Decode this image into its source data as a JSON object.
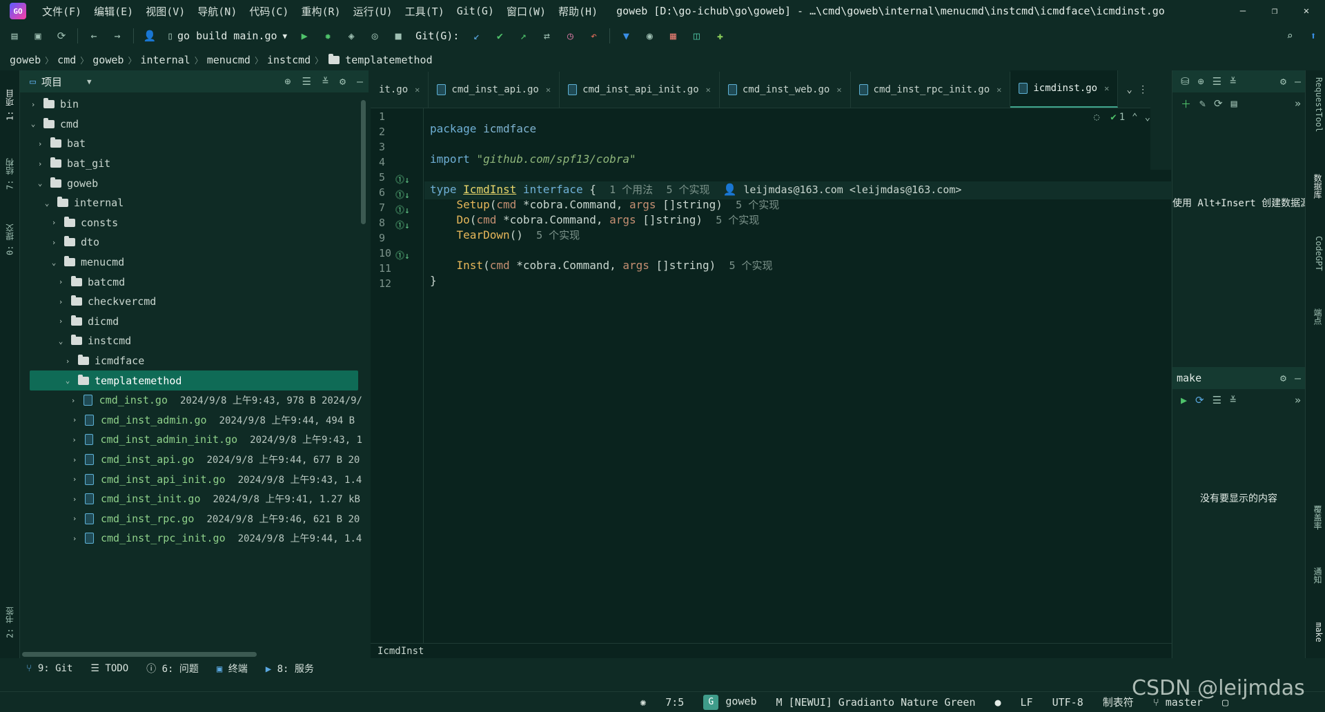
{
  "app": {
    "logo_text": "GO"
  },
  "menu": [
    "文件(F)",
    "编辑(E)",
    "视图(V)",
    "导航(N)",
    "代码(C)",
    "重构(R)",
    "运行(U)",
    "工具(T)",
    "Git(G)",
    "窗口(W)",
    "帮助(H)"
  ],
  "window_title": "goweb [D:\\go-ichub\\go\\goweb] - …\\cmd\\goweb\\internal\\menucmd\\instcmd\\icmdface\\icmdinst.go",
  "window_controls": {
    "minimize": "—",
    "maximize": "❐",
    "close": "✕"
  },
  "toolbar": {
    "run_config": "go build main.go",
    "git_label": "Git(G):"
  },
  "breadcrumb": [
    "goweb",
    "cmd",
    "goweb",
    "internal",
    "menucmd",
    "instcmd",
    "templatemethod"
  ],
  "project_panel": {
    "title": "项目"
  },
  "tree": [
    {
      "label": "bin",
      "type": "folder",
      "depth": 0,
      "expanded": false
    },
    {
      "label": "cmd",
      "type": "folder",
      "depth": 0,
      "expanded": true
    },
    {
      "label": "bat",
      "type": "folder",
      "depth": 1,
      "expanded": false
    },
    {
      "label": "bat_git",
      "type": "folder",
      "depth": 1,
      "expanded": false
    },
    {
      "label": "goweb",
      "type": "folder",
      "depth": 1,
      "expanded": true
    },
    {
      "label": "internal",
      "type": "folder",
      "depth": 2,
      "expanded": true
    },
    {
      "label": "consts",
      "type": "folder",
      "depth": 3,
      "expanded": false
    },
    {
      "label": "dto",
      "type": "folder",
      "depth": 3,
      "expanded": false
    },
    {
      "label": "menucmd",
      "type": "folder",
      "depth": 3,
      "expanded": true
    },
    {
      "label": "batcmd",
      "type": "folder",
      "depth": 4,
      "expanded": false
    },
    {
      "label": "checkvercmd",
      "type": "folder",
      "depth": 4,
      "expanded": false
    },
    {
      "label": "dicmd",
      "type": "folder",
      "depth": 4,
      "expanded": false
    },
    {
      "label": "instcmd",
      "type": "folder",
      "depth": 4,
      "expanded": true
    },
    {
      "label": "icmdface",
      "type": "folder",
      "depth": 5,
      "expanded": false
    },
    {
      "label": "templatemethod",
      "type": "folder",
      "depth": 5,
      "expanded": true,
      "selected": true
    },
    {
      "label": "cmd_inst.go",
      "type": "file",
      "depth": 6,
      "meta": "2024/9/8 上午9:43, 978 B 2024/9/"
    },
    {
      "label": "cmd_inst_admin.go",
      "type": "file",
      "depth": 6,
      "meta": "2024/9/8 上午9:44, 494 B"
    },
    {
      "label": "cmd_inst_admin_init.go",
      "type": "file",
      "depth": 6,
      "meta": "2024/9/8 上午9:43, 1"
    },
    {
      "label": "cmd_inst_api.go",
      "type": "file",
      "depth": 6,
      "meta": "2024/9/8 上午9:44, 677 B 20"
    },
    {
      "label": "cmd_inst_api_init.go",
      "type": "file",
      "depth": 6,
      "meta": "2024/9/8 上午9:43, 1.4"
    },
    {
      "label": "cmd_inst_init.go",
      "type": "file",
      "depth": 6,
      "meta": "2024/9/8 上午9:41, 1.27 kB"
    },
    {
      "label": "cmd_inst_rpc.go",
      "type": "file",
      "depth": 6,
      "meta": "2024/9/8 上午9:46, 621 B 20"
    },
    {
      "label": "cmd_inst_rpc_init.go",
      "type": "file",
      "depth": 6,
      "meta": "2024/9/8 上午9:44, 1.4"
    }
  ],
  "tabs": [
    {
      "label": "it.go",
      "active": false
    },
    {
      "label": "cmd_inst_api.go",
      "active": false
    },
    {
      "label": "cmd_inst_api_init.go",
      "active": false
    },
    {
      "label": "cmd_inst_web.go",
      "active": false
    },
    {
      "label": "cmd_inst_rpc_init.go",
      "active": false
    },
    {
      "label": "icmdinst.go",
      "active": true
    }
  ],
  "editor": {
    "inspection_count": "1",
    "line_numbers": [
      "1",
      "2",
      "3",
      "4",
      "5",
      "6",
      "7",
      "8",
      "9",
      "10",
      "11",
      "12"
    ],
    "code": {
      "l1_kw": "package",
      "l1_name": "icmdface",
      "l3_kw": "import",
      "l3_str": "\"github.com/spf13/cobra\"",
      "l5_kw": "type",
      "l5_type": "IcmdInst",
      "l5_kw2": "interface",
      "l5_brace": "{",
      "l5_hint1": "1 个用法",
      "l5_hint2": "5 个实现",
      "l5_author": "leijmdas@163.com <leijmdas@163.com>",
      "l6_fn": "Setup",
      "l6_sig_a": "cmd",
      "l6_sig_b": " *cobra.Command, ",
      "l6_sig_c": "args",
      "l6_sig_d": " []string)",
      "l6_hint": "5 个实现",
      "l7_fn": "Do",
      "l7_sig_a": "cmd",
      "l7_sig_b": " *cobra.Command, ",
      "l7_sig_c": "args",
      "l7_sig_d": " []string)",
      "l7_hint": "5 个实现",
      "l8_fn": "TearDown",
      "l8_sig": "()",
      "l8_hint": "5 个实现",
      "l10_fn": "Inst",
      "l10_sig_a": "cmd",
      "l10_sig_b": " *cobra.Command, ",
      "l10_sig_c": "args",
      "l10_sig_d": " []string)",
      "l10_hint": "5 个实现",
      "l11": "}"
    },
    "status_symbol": "IcmdInst"
  },
  "right_panel": {
    "db_hint": "使用 Alt+Insert 创建数据源",
    "make_title": "make",
    "make_empty": "没有要显示的内容"
  },
  "right_strip": [
    "RequestTool",
    "数据库",
    "CodeGPT",
    "端点",
    "覆盖率",
    "通知",
    "make"
  ],
  "left_strip": [
    "1: 项目",
    "7: 结构",
    "0: 提交",
    "2: 书签"
  ],
  "bottom_tabs": [
    "9: Git",
    "TODO",
    "6: 问题",
    "终端",
    "8: 服务"
  ],
  "statusbar": {
    "position": "7:5",
    "badge": "G",
    "project": "goweb",
    "theme": "[NEWUI] Gradianto Nature Green",
    "line_sep": "LF",
    "encoding": "UTF-8",
    "indent": "制表符",
    "branch": "master"
  },
  "watermark": "CSDN @leijmdas",
  "colors": {
    "bg": "#0f2b25",
    "editor_bg": "#0a231e",
    "selection": "#0f6b56",
    "accent": "#3fa58d"
  }
}
